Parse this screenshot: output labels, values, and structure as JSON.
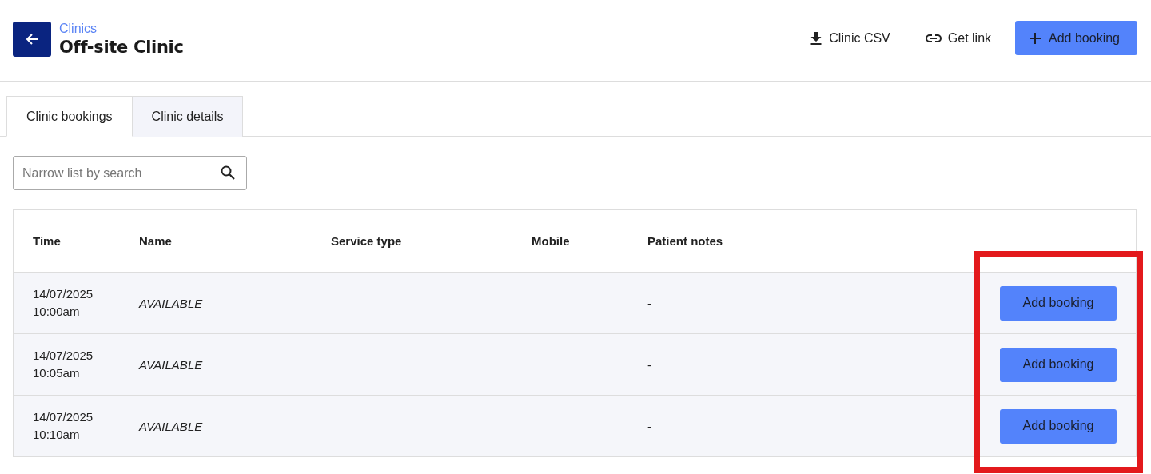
{
  "header": {
    "breadcrumb": "Clinics",
    "title": "Off-site Clinic",
    "actions": [
      {
        "kind": "download",
        "label": "Clinic CSV"
      },
      {
        "kind": "link",
        "label": "Get link"
      },
      {
        "kind": "primary",
        "label": "Add booking"
      }
    ]
  },
  "tabs": [
    {
      "label": "Clinic bookings",
      "selected": true
    },
    {
      "label": "Clinic details",
      "selected": false
    }
  ],
  "search": {
    "placeholder": "Narrow list by search"
  },
  "table": {
    "columns": [
      "Time",
      "Name",
      "Service type",
      "Mobile",
      "Patient notes"
    ],
    "rows": [
      {
        "date": "14/07/2025",
        "time": "10:00am",
        "name": "AVAILABLE",
        "service_type": "",
        "mobile": "",
        "notes": "-",
        "action": "Add booking"
      },
      {
        "date": "14/07/2025",
        "time": "10:05am",
        "name": "AVAILABLE",
        "service_type": "",
        "mobile": "",
        "notes": "-",
        "action": "Add booking"
      },
      {
        "date": "14/07/2025",
        "time": "10:10am",
        "name": "AVAILABLE",
        "service_type": "",
        "mobile": "",
        "notes": "-",
        "action": "Add booking"
      }
    ]
  }
}
